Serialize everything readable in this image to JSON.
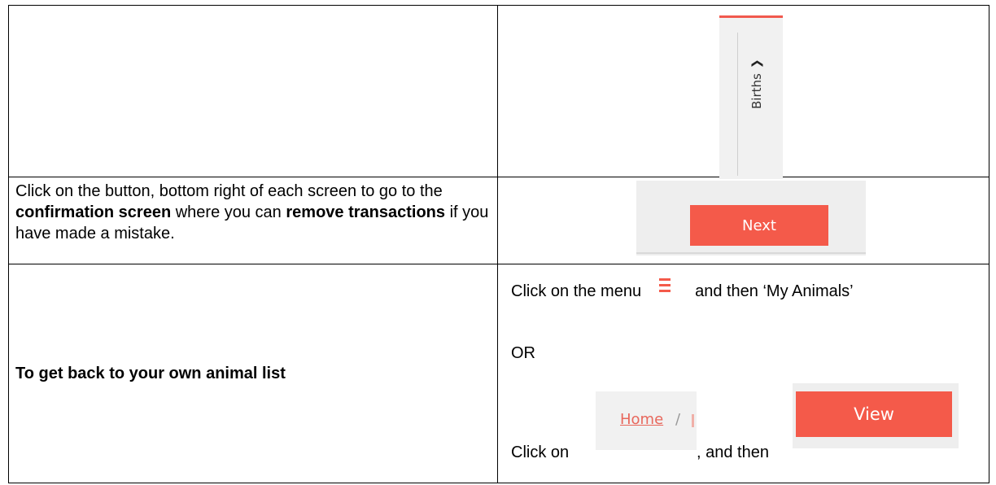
{
  "rows": [
    {
      "left_text": "",
      "right": {
        "tab_label": "Births",
        "chevron_icon": "chevron-right-icon"
      }
    },
    {
      "left": {
        "part1": "Click on the button, bottom right of each screen to go to the ",
        "bold1": "confirmation screen",
        "part2": " where you can ",
        "bold2": "remove transactions",
        "part3": " if you have made a mistake."
      },
      "right": {
        "next_label": "Next"
      }
    },
    {
      "left": {
        "heading": "To get back to your own animal list"
      },
      "right": {
        "line1_before": "Click on the menu",
        "menu_icon": "hamburger-menu-icon",
        "line1_after": "and then ‘My Animals’",
        "or_text": "OR",
        "click_on": "Click on",
        "breadcrumb_home": "Home",
        "breadcrumb_sep": "/",
        "and_then": ", and then",
        "view_label": "View"
      }
    }
  ],
  "colors": {
    "accent": "#f45a4a",
    "link": "#e8675c"
  }
}
